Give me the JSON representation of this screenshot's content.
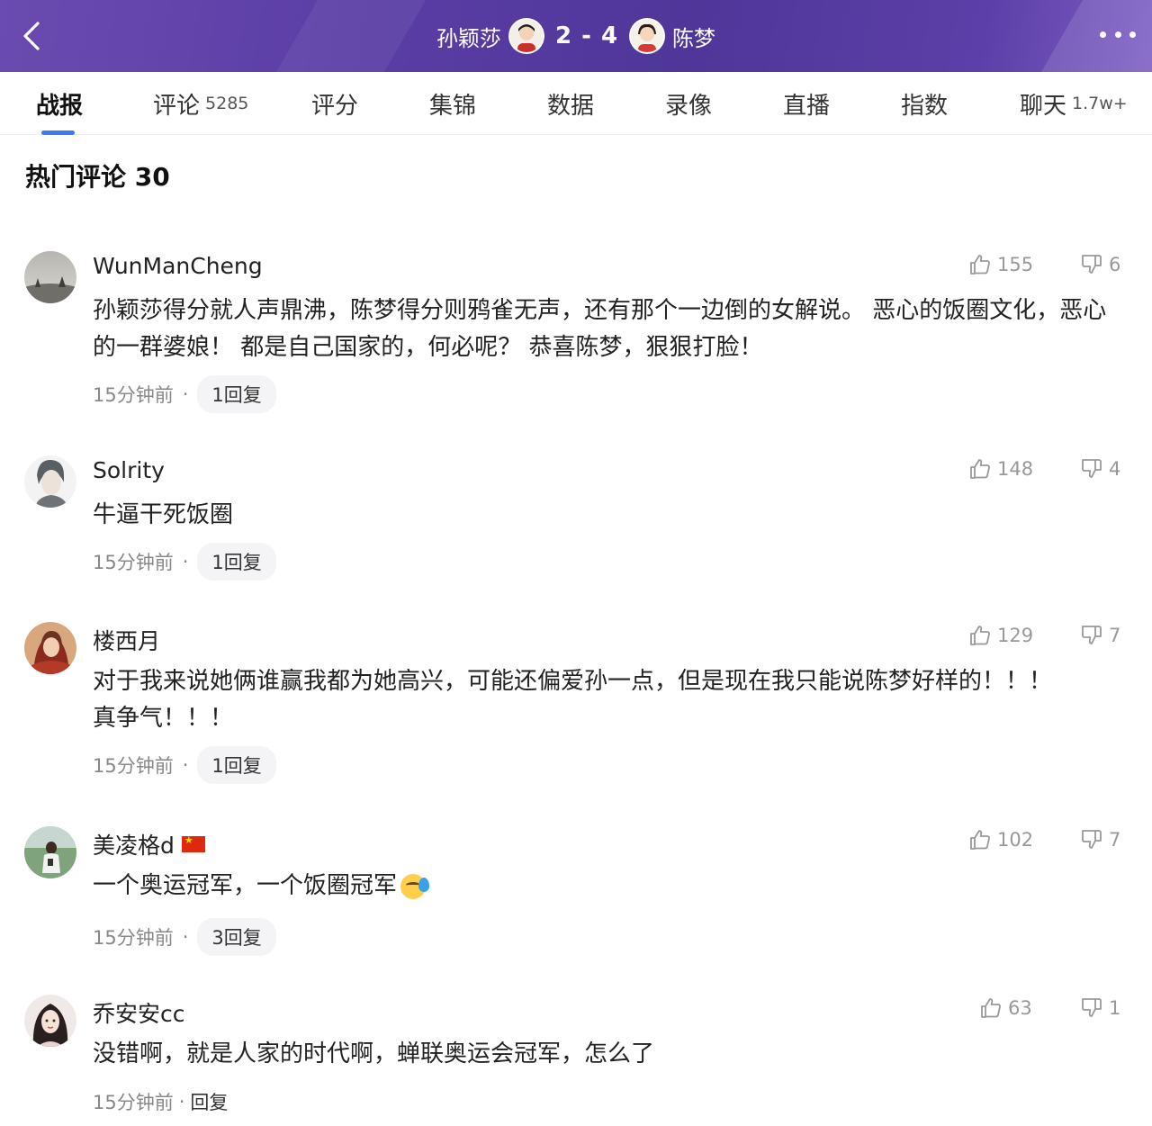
{
  "header": {
    "player1": "孙颖莎",
    "score": "2 - 4",
    "player2": "陈梦"
  },
  "tabs": [
    {
      "label": "战报",
      "sub": ""
    },
    {
      "label": "评论",
      "sub": "5285"
    },
    {
      "label": "评分",
      "sub": ""
    },
    {
      "label": "集锦",
      "sub": ""
    },
    {
      "label": "数据",
      "sub": ""
    },
    {
      "label": "录像",
      "sub": ""
    },
    {
      "label": "直播",
      "sub": ""
    },
    {
      "label": "指数",
      "sub": ""
    },
    {
      "label": "聊天",
      "sub": "1.7w+"
    }
  ],
  "section_title": "热门评论 30",
  "comments": [
    {
      "user": "WunManCheng",
      "text": "孙颖莎得分就人声鼎沸，陈梦得分则鸦雀无声，还有那个一边倒的女解说。 恶心的饭圈文化，恶心的一群婆娘！ 都是自己国家的，何必呢？ 恭喜陈梦，狠狠打脸！",
      "time": "15分钟前",
      "replies": "1回复",
      "likes": "155",
      "dislikes": "6"
    },
    {
      "user": "Solrity",
      "text": "牛逼干死饭圈",
      "time": "15分钟前",
      "replies": "1回复",
      "likes": "148",
      "dislikes": "4"
    },
    {
      "user": "楼西月",
      "text": "对于我来说她俩谁赢我都为她高兴，可能还偏爱孙一点，但是现在我只能说陈梦好样的！！！ 真争气！！！",
      "time": "15分钟前",
      "replies": "1回复",
      "likes": "129",
      "dislikes": "7"
    },
    {
      "user": "美凌格d",
      "text": "一个奥运冠军，一个饭圈冠军",
      "time": "15分钟前",
      "replies": "3回复",
      "likes": "102",
      "dislikes": "7"
    },
    {
      "user": "乔安安cc",
      "text": "没错啊，就是人家的时代啊，蝉联奥运会冠军，怎么了",
      "time": "15分钟前",
      "replies": "回复",
      "likes": "63",
      "dislikes": "1"
    }
  ],
  "colors": {
    "header_bg": "#5b3ea6",
    "tab_indicator": "#3a7bf0"
  },
  "icons": [
    "back-arrow-icon",
    "more-dots-icon",
    "thumbs-up-icon",
    "thumbs-down-icon"
  ]
}
